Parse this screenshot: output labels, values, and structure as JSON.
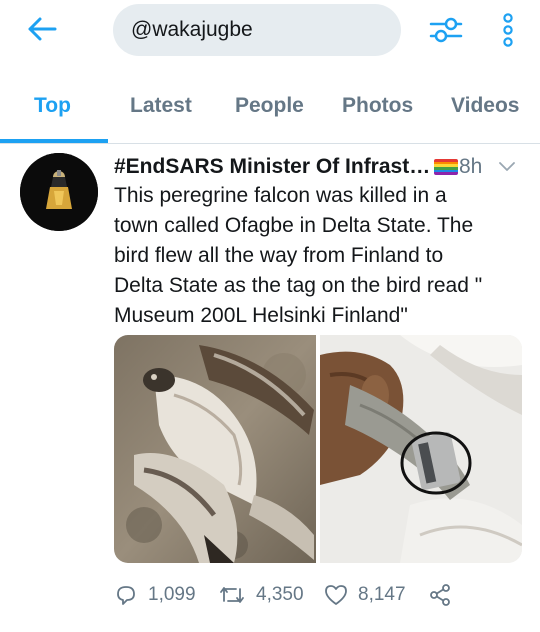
{
  "search": {
    "query": "@wakajugbe"
  },
  "tabs": [
    {
      "label": "Top",
      "active": true
    },
    {
      "label": "Latest",
      "active": false
    },
    {
      "label": "People",
      "active": false
    },
    {
      "label": "Photos",
      "active": false
    },
    {
      "label": "Videos",
      "active": false
    }
  ],
  "tweet": {
    "display_name": "#EndSARS Minister Of Infrastr...",
    "time": "8h",
    "text_lines": [
      "This peregrine falcon was killed in a",
      "town called Ofagbe in Delta State. The",
      "bird flew all the way from Finland to",
      "Delta State as the tag on the bird read \"",
      "Museum 200L Helsinki Finland\""
    ],
    "reply_count": "1,099",
    "retweet_count": "4,350",
    "like_count": "8,147"
  },
  "colors": {
    "accent": "#1da1f2",
    "muted": "#657786",
    "search_bg": "#e6ecf0"
  },
  "icons": [
    "back-arrow-icon",
    "filter-sliders-icon",
    "more-vertical-icon",
    "chevron-down-icon",
    "reply-icon",
    "retweet-icon",
    "like-icon",
    "share-icon"
  ]
}
